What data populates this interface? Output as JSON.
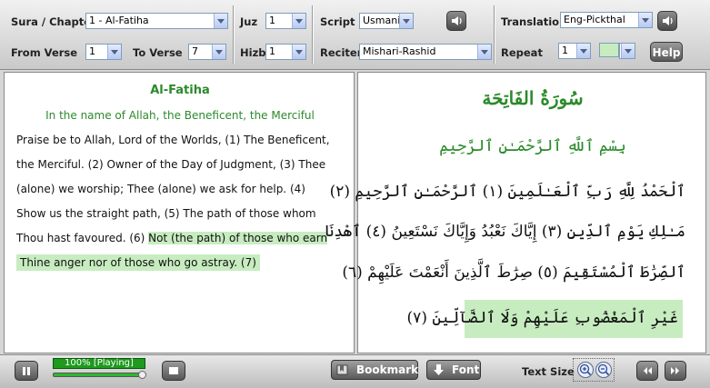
{
  "toolbar": {
    "sura_label": "Sura / Chapter",
    "sura_value": "1 - Al-Fatiha",
    "juz_label": "Juz",
    "juz_value": "1",
    "script_label": "Script",
    "script_value": "Usmani",
    "translation_label": "Translation",
    "translation_value": "Eng-Pickthal",
    "from_label": "From Verse",
    "from_value": "1",
    "to_label": "To Verse",
    "to_value": "7",
    "hizb_label": "Hizb",
    "hizb_value": "1",
    "reciter_label": "Reciter",
    "reciter_value": "Mishari-Rashid",
    "repeat_label": "Repeat",
    "repeat_value": "1",
    "highlight_color": "#c7ecc0",
    "help_label": "Help"
  },
  "translation": {
    "title": "Al-Fatiha",
    "bismillah": "In the name of Allah, the Beneficent, the Merciful",
    "lines": [
      "Praise be to Allah, Lord of the Worlds, (1) The Beneficent,",
      "the Merciful. (2) Owner of the Day of Judgment, (3) Thee",
      "(alone) we worship; Thee (alone) we ask for help. (4)",
      "Show us the straight path, (5) The path of those whom"
    ],
    "line5_plain": "Thou hast favoured. (6) ",
    "line5_highlight": "Not (the path) of those who earn",
    "line6_highlight": "Thine anger nor of those who go astray. (7)"
  },
  "arabic": {
    "title": "سُورَةُ الفَاتِحَة",
    "bismillah": "بِسْمِ ٱللَّهِ ٱلرَّحْمَـٰنِ ٱلرَّحِيمِ",
    "lines": [
      "ٱلْحَمْدُ لِلَّهِ رَبِّ ٱلْعَـٰلَمِينَ (١) ٱلرَّحْمَـٰنِ ٱلرَّحِيمِ (٢)",
      "مَـٰلِكِ يَوْمِ ٱلدِّينِ (٣) إِيَّاكَ نَعْبُدُ وَإِيَّاكَ نَسْتَعِينُ (٤) ٱهْدِنَا",
      "ٱلصِّرَٰطَ ٱلْمُسْتَقِيمَ (٥) صِرَٰطَ ٱلَّذِينَ أَنْعَمْتَ عَلَيْهِمْ (٦)"
    ],
    "highlight_line": "غَيْرِ ٱلْمَغْضُوبِ عَلَيْهِمْ وَلَا ٱلضَّآلِّينَ (٧)"
  },
  "player": {
    "progress_text": "100%  [Playing]",
    "progress_percent": 100,
    "bookmark_label": "Bookmark",
    "font_label": "Font",
    "text_size_label": "Text Size"
  },
  "icons": [
    "speaker-icon",
    "pause-icon",
    "stop-icon",
    "bookmark-icon",
    "font-arrow-icon",
    "zoom-in-icon",
    "zoom-out-icon",
    "previous-icon",
    "next-icon"
  ]
}
